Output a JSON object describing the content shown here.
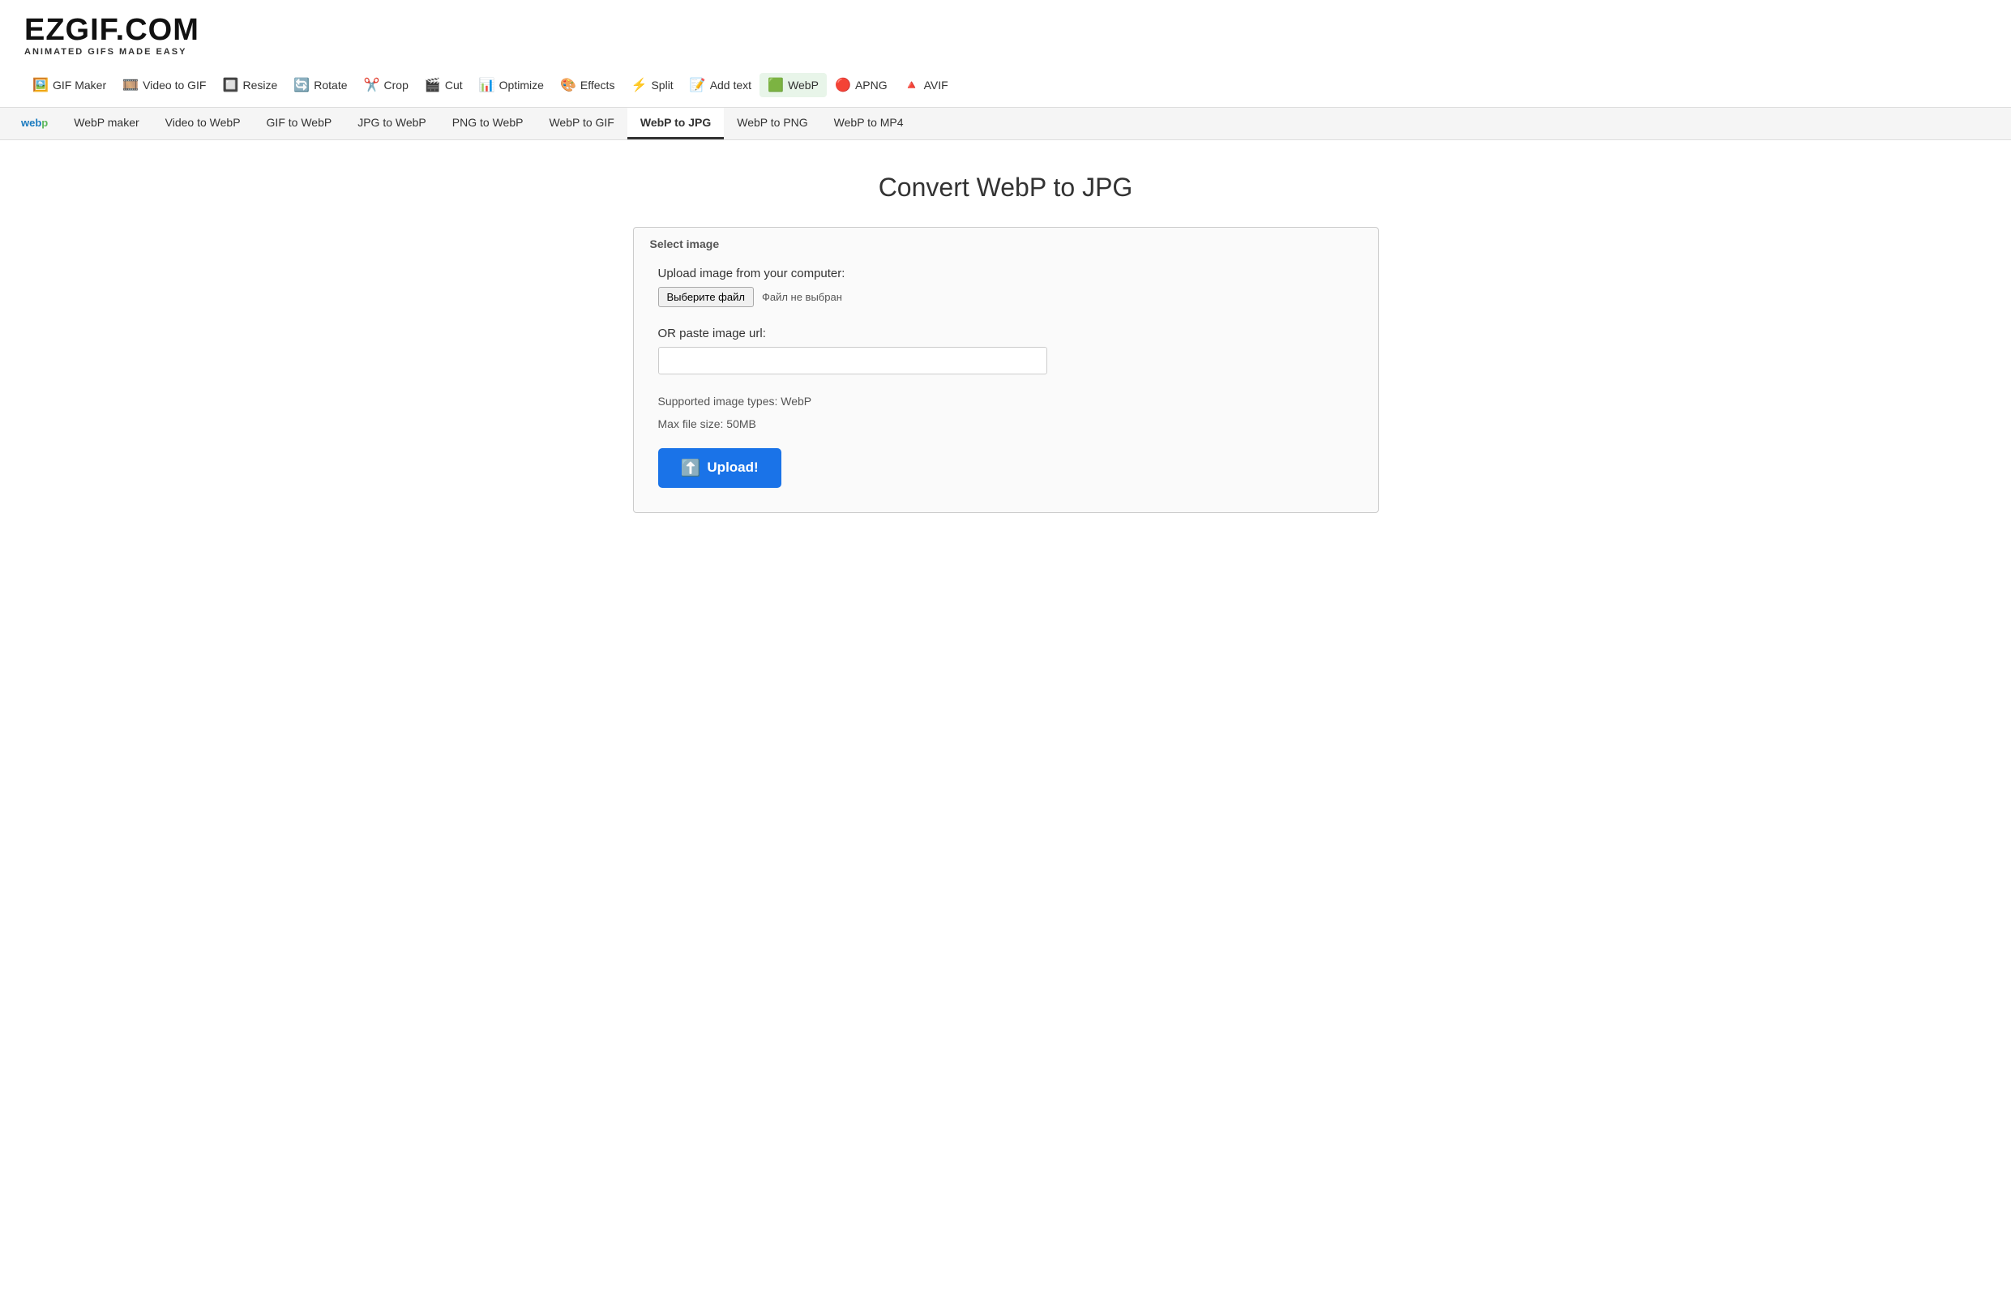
{
  "logo": {
    "text": "EZGIF.COM",
    "tagline": "ANIMATED GIFS MADE EASY"
  },
  "nav": {
    "items": [
      {
        "id": "gif-maker",
        "label": "GIF Maker",
        "icon": "🖼️"
      },
      {
        "id": "video-to-gif",
        "label": "Video to GIF",
        "icon": "🎞️"
      },
      {
        "id": "resize",
        "label": "Resize",
        "icon": "🔲"
      },
      {
        "id": "rotate",
        "label": "Rotate",
        "icon": "🔄"
      },
      {
        "id": "crop",
        "label": "Crop",
        "icon": "✂️"
      },
      {
        "id": "cut",
        "label": "Cut",
        "icon": "🎬"
      },
      {
        "id": "optimize",
        "label": "Optimize",
        "icon": "📊"
      },
      {
        "id": "effects",
        "label": "Effects",
        "icon": "🎨"
      },
      {
        "id": "split",
        "label": "Split",
        "icon": "⚡"
      },
      {
        "id": "add-text",
        "label": "Add text",
        "icon": "📝"
      },
      {
        "id": "webp",
        "label": "WebP",
        "icon": "🟩"
      }
    ],
    "row2": [
      {
        "id": "apng",
        "label": "APNG",
        "icon": "🔴"
      },
      {
        "id": "avif",
        "label": "AVIF",
        "icon": "🔺"
      }
    ]
  },
  "subnav": {
    "logo_part1": "web",
    "logo_part2": "p",
    "items": [
      {
        "id": "webp-maker",
        "label": "WebP maker",
        "active": false
      },
      {
        "id": "video-to-webp",
        "label": "Video to WebP",
        "active": false
      },
      {
        "id": "gif-to-webp",
        "label": "GIF to WebP",
        "active": false
      },
      {
        "id": "jpg-to-webp",
        "label": "JPG to WebP",
        "active": false
      },
      {
        "id": "png-to-webp",
        "label": "PNG to WebP",
        "active": false
      },
      {
        "id": "webp-to-gif",
        "label": "WebP to GIF",
        "active": false
      },
      {
        "id": "webp-to-jpg",
        "label": "WebP to JPG",
        "active": true
      },
      {
        "id": "webp-to-png",
        "label": "WebP to PNG",
        "active": false
      },
      {
        "id": "webp-to-mp4",
        "label": "WebP to MP4",
        "active": false
      }
    ]
  },
  "main": {
    "page_title": "Convert WebP to JPG",
    "form": {
      "legend": "Select image",
      "upload_label": "Upload image from your computer:",
      "file_button_label": "Выберите файл",
      "file_no_chosen": "Файл не выбран",
      "or_paste_label": "OR paste image url:",
      "url_placeholder": "",
      "supported_types": "Supported image types: WebP",
      "max_file_size": "Max file size: 50MB",
      "upload_button_label": "Upload!"
    }
  }
}
